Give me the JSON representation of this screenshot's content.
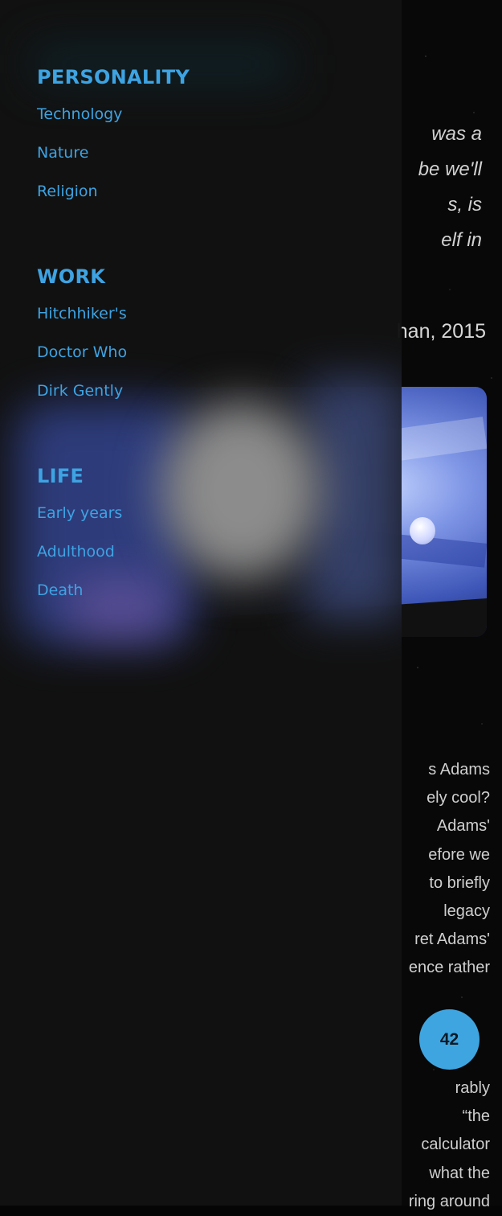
{
  "background": {
    "quote_lines": [
      "was a",
      "be we'll",
      "s, is",
      "elf in"
    ],
    "quote_attribution": "han, 2015",
    "paragraph1_lines": [
      "s Adams",
      "ely cool?",
      "Adams'",
      "efore we",
      "to briefly",
      "legacy",
      "ret Adams'",
      "ence rather"
    ],
    "paragraph2_lines": [
      "rably",
      "“the",
      "calculator",
      "what the",
      "ring around"
    ],
    "badge_value": "42"
  },
  "drawer": {
    "sections": [
      {
        "heading": "PERSONALITY",
        "links": [
          "Technology",
          "Nature",
          "Religion"
        ]
      },
      {
        "heading": "WORK",
        "links": [
          "Hitchhiker's",
          "Doctor Who",
          "Dirk Gently"
        ]
      },
      {
        "heading": "LIFE",
        "links": [
          "Early years",
          "Adulthood",
          "Death"
        ]
      }
    ]
  },
  "colors": {
    "accent": "#3ea3e2",
    "drawer_bg": "#121212",
    "page_bg": "#080808"
  }
}
